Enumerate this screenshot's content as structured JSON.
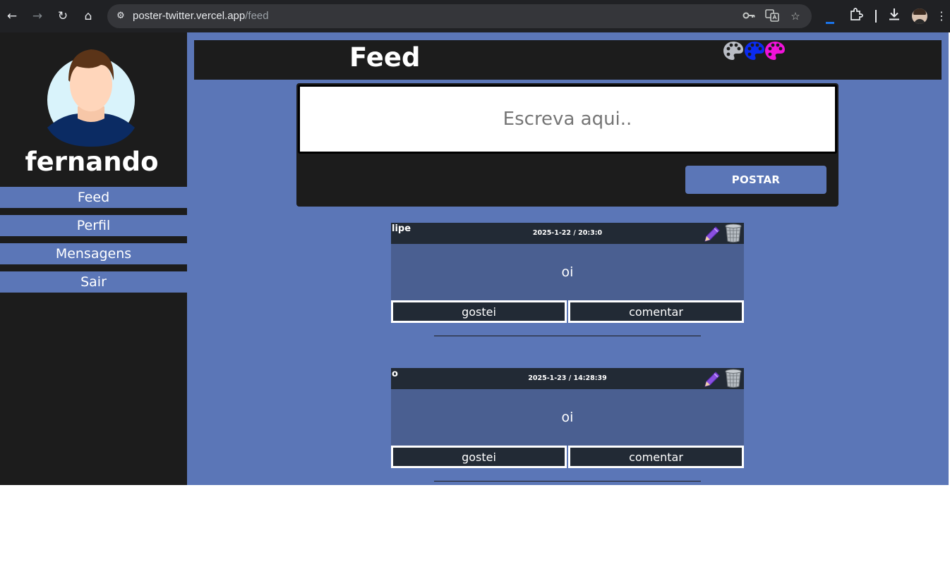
{
  "browser": {
    "url_host": "poster-twitter.vercel.app",
    "url_path": "/feed",
    "icons": [
      "back-icon",
      "forward-icon",
      "reload-icon",
      "home-icon",
      "site-settings-icon",
      "password-key-icon",
      "translate-icon",
      "bookmark-star-icon",
      "extensions-icon",
      "downloads-icon",
      "profile-avatar",
      "more-menu-icon"
    ]
  },
  "sidebar": {
    "username": "fernando",
    "menu": [
      {
        "label": "Feed"
      },
      {
        "label": "Perfil"
      },
      {
        "label": "Mensagens"
      },
      {
        "label": "Sair"
      }
    ]
  },
  "header": {
    "title": "Feed",
    "theme_palettes": [
      {
        "name": "gray-palette-icon",
        "color": "#b9bcc4"
      },
      {
        "name": "blue-palette-icon",
        "color": "#0b2bf0"
      },
      {
        "name": "magenta-palette-icon",
        "color": "#f012d9"
      }
    ]
  },
  "composer": {
    "placeholder": "Escreva aqui..",
    "post_label": "POSTAR"
  },
  "posts": [
    {
      "author": "lipe",
      "date": "2025-1-22 / 20:3:0",
      "content": "oi",
      "like_label": "gostei",
      "comment_label": "comentar",
      "divider": "____________________________________________________"
    },
    {
      "author": "o",
      "date": "2025-1-23 / 14:28:39",
      "content": "oi",
      "like_label": "gostei",
      "comment_label": "comentar",
      "divider": "____________________________________________________"
    }
  ],
  "colors": {
    "page_background": "#5b76b7",
    "panel": "#1c1c1c",
    "post_header": "#222a35",
    "post_body": "#4a5f91",
    "accent_button": "#5b76b7"
  }
}
